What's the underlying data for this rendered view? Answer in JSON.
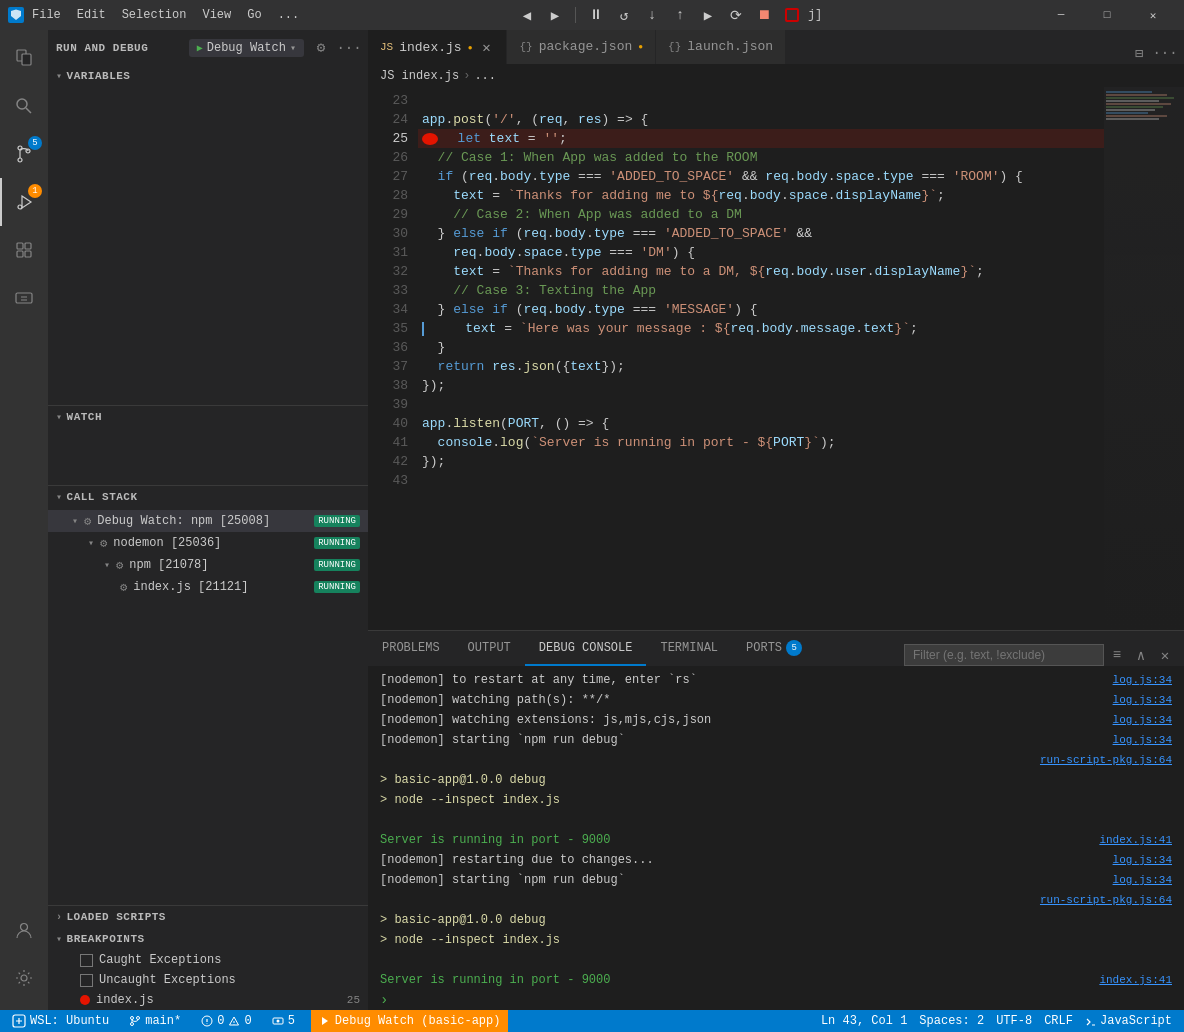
{
  "titleBar": {
    "menus": [
      "File",
      "Edit",
      "Selection",
      "View",
      "Go",
      "..."
    ],
    "debugControls": [
      "⏸",
      "↺",
      "↓",
      "↑",
      "▶",
      "⟳",
      "⏹"
    ],
    "winControls": [
      "─",
      "□",
      "✕"
    ],
    "filename": "j]"
  },
  "tabs": [
    {
      "icon": "JS",
      "name": "index.js",
      "modified": true,
      "active": true,
      "closeable": true
    },
    {
      "icon": "{}",
      "name": "package.json",
      "modified": true,
      "active": false,
      "closeable": false
    },
    {
      "icon": "{}",
      "name": "launch.json",
      "modified": false,
      "active": false,
      "closeable": false
    }
  ],
  "breadcrumb": [
    "JS index.js",
    ">",
    "..."
  ],
  "sidebar": {
    "title": "RUN AND DEBUG",
    "debugSession": "Debug Watch",
    "sections": {
      "variables": "VARIABLES",
      "watch": "WATCH",
      "callStack": "CALL STACK",
      "loadedScripts": "LOADED SCRIPTS",
      "breakpoints": "BREAKPOINTS"
    },
    "callStackItems": [
      {
        "name": "Debug Watch: npm [25008]",
        "status": "RUNNING",
        "indent": 0,
        "type": "session"
      },
      {
        "name": "nodemon [25036]",
        "status": "RUNNING",
        "indent": 1,
        "type": "process"
      },
      {
        "name": "npm [21078]",
        "status": "RUNNING",
        "indent": 2,
        "type": "process"
      },
      {
        "name": "index.js [21121]",
        "status": "RUNNING",
        "indent": 3,
        "type": "file"
      }
    ],
    "breakpoints": [
      {
        "name": "Caught Exceptions",
        "checked": false
      },
      {
        "name": "Uncaught Exceptions",
        "checked": false
      },
      {
        "name": "index.js",
        "checked": true,
        "line": 25,
        "hasDot": true
      }
    ]
  },
  "codeLines": [
    {
      "num": 23,
      "content": ""
    },
    {
      "num": 24,
      "content": "app.post('/', (req, res) => {",
      "type": "normal"
    },
    {
      "num": 25,
      "content": "  let text = '';",
      "type": "breakpoint"
    },
    {
      "num": 26,
      "content": "  // Case 1: When App was added to the ROOM",
      "type": "comment"
    },
    {
      "num": 27,
      "content": "  if (req.body.type === 'ADDED_TO_SPACE' && req.body.space.type === 'ROOM') {",
      "type": "normal"
    },
    {
      "num": 28,
      "content": "    text = `Thanks for adding me to ${req.body.space.displayName}`;",
      "type": "template"
    },
    {
      "num": 29,
      "content": "    // Case 2: When App was added to a DM",
      "type": "comment"
    },
    {
      "num": 30,
      "content": "  } else if (req.body.type === 'ADDED_TO_SPACE' &&",
      "type": "normal"
    },
    {
      "num": 31,
      "content": "    req.body.space.type === 'DM') {",
      "type": "normal"
    },
    {
      "num": 32,
      "content": "    text = `Thanks for adding me to a DM, ${req.body.user.displayName}`;",
      "type": "template"
    },
    {
      "num": 33,
      "content": "    // Case 3: Texting the App",
      "type": "comment"
    },
    {
      "num": 34,
      "content": "  } else if (req.body.type === 'MESSAGE') {",
      "type": "normal"
    },
    {
      "num": 35,
      "content": "    text = `Here was your message : ${req.body.message.text}`;",
      "type": "template"
    },
    {
      "num": 36,
      "content": "  }",
      "type": "normal"
    },
    {
      "num": 37,
      "content": "  return res.json({text});",
      "type": "normal"
    },
    {
      "num": 38,
      "content": "});",
      "type": "normal"
    },
    {
      "num": 39,
      "content": ""
    },
    {
      "num": 40,
      "content": "app.listen(PORT, () => {",
      "type": "normal"
    },
    {
      "num": 41,
      "content": "  console.log(`Server is running in port - ${PORT}`);",
      "type": "template"
    },
    {
      "num": 42,
      "content": "});",
      "type": "normal"
    },
    {
      "num": 43,
      "content": ""
    }
  ],
  "panel": {
    "tabs": [
      "PROBLEMS",
      "OUTPUT",
      "DEBUG CONSOLE",
      "TERMINAL",
      "PORTS"
    ],
    "portsCount": 5,
    "activeTab": "DEBUG CONSOLE",
    "filterPlaceholder": "Filter (e.g. text, !exclude)"
  },
  "consoleLines": [
    {
      "text": "[nodemon] to restart at any time, enter `rs`",
      "source": "log.js:34",
      "type": "normal"
    },
    {
      "text": "[nodemon] watching path(s): **/*",
      "source": "log.js:34",
      "type": "normal"
    },
    {
      "text": "[nodemon] watching extensions: js,mjs,cjs,json",
      "source": "log.js:34",
      "type": "normal"
    },
    {
      "text": "[nodemon] starting `npm run debug`",
      "source": "log.js:34",
      "type": "normal"
    },
    {
      "text": "",
      "source": "run-script-pkg.js:64",
      "type": "spacer"
    },
    {
      "text": "> basic-app@1.0.0 debug",
      "source": "",
      "type": "prompt"
    },
    {
      "text": "> node --inspect index.js",
      "source": "",
      "type": "prompt"
    },
    {
      "text": "",
      "source": "",
      "type": "spacer"
    },
    {
      "text": "Server is running in port - 9000",
      "source": "index.js:41",
      "type": "green"
    },
    {
      "text": "[nodemon] restarting due to changes...",
      "source": "log.js:34",
      "type": "normal"
    },
    {
      "text": "[nodemon] starting `npm run debug`",
      "source": "log.js:34",
      "type": "normal"
    },
    {
      "text": "",
      "source": "run-script-pkg.js:64",
      "type": "spacer"
    },
    {
      "text": "> basic-app@1.0.0 debug",
      "source": "",
      "type": "prompt"
    },
    {
      "text": "> node --inspect index.js",
      "source": "",
      "type": "prompt"
    },
    {
      "text": "",
      "source": "",
      "type": "spacer"
    },
    {
      "text": "Server is running in port - 9000",
      "source": "index.js:41",
      "type": "green"
    }
  ],
  "statusBar": {
    "wsl": "WSL: Ubuntu",
    "branch": "main*",
    "errors": "0",
    "warnings": "0",
    "ports": "5",
    "debugSession": "Debug Watch (basic-app)",
    "position": "Ln 43, Col 1",
    "spaces": "Spaces: 2",
    "encoding": "UTF-8",
    "lineEnding": "CRLF",
    "language": "JavaScript"
  }
}
